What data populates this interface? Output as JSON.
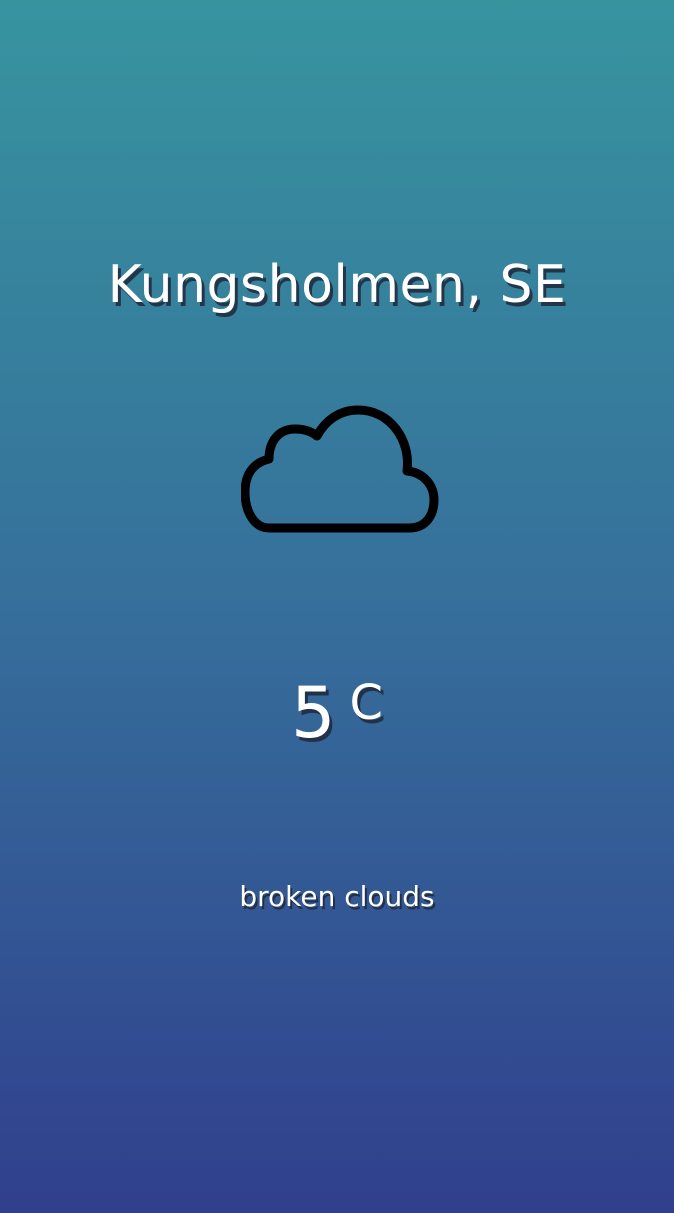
{
  "location": {
    "name": "Kungsholmen, SE"
  },
  "weather": {
    "icon": "cloud-icon",
    "temperature": "5",
    "unit": "C",
    "description": "broken clouds"
  },
  "colors": {
    "gradient_top": "#37949f",
    "gradient_mid": "#366f9b",
    "gradient_bottom": "#303f8d",
    "text": "#ffffff",
    "icon_stroke": "#000000"
  }
}
